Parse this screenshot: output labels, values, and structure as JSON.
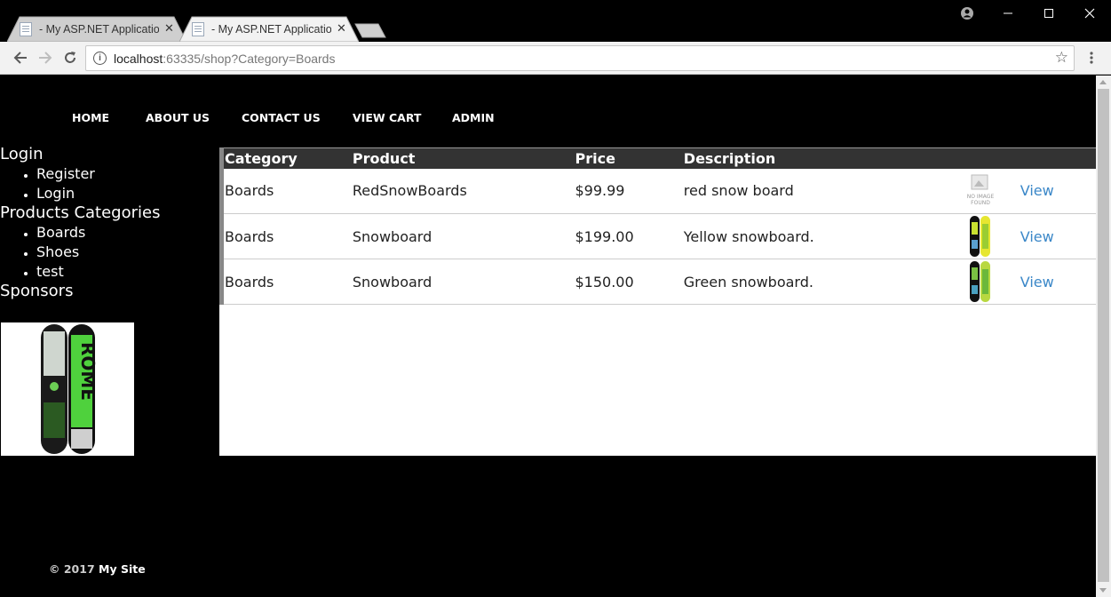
{
  "browser": {
    "tabs": [
      {
        "title": "- My ASP.NET Application",
        "active": false
      },
      {
        "title": "- My ASP.NET Application",
        "active": true
      }
    ],
    "url_host": "localhost",
    "url_rest": ":63335/shop?Category=Boards"
  },
  "nav": {
    "items": [
      "HOME",
      "ABOUT US",
      "CONTACT US",
      "VIEW CART",
      "ADMIN"
    ]
  },
  "sidebar": {
    "login_heading": "Login",
    "login_items": [
      "Register",
      "Login"
    ],
    "categories_heading": "Products Categories",
    "categories": [
      "Boards",
      "Shoes",
      "test"
    ],
    "sponsors_heading": "Sponsors"
  },
  "products": {
    "headers": [
      "Category",
      "Product",
      "Price",
      "Description"
    ],
    "rows": [
      {
        "category": "Boards",
        "product": "RedSnowBoards",
        "price": "$99.99",
        "description": "red snow board",
        "image": "no-image",
        "link": "View"
      },
      {
        "category": "Boards",
        "product": "Snowboard",
        "price": "$199.00",
        "description": "Yellow snowboard.",
        "image": "snowboard-yellow",
        "link": "View"
      },
      {
        "category": "Boards",
        "product": "Snowboard",
        "price": "$150.00",
        "description": "Green snowboard.",
        "image": "snowboard-green",
        "link": "View"
      }
    ],
    "no_image_text": [
      "NO IMAGE",
      "FOUND"
    ]
  },
  "footer": {
    "copyright": "© 2017",
    "site": "My Site"
  },
  "colors": {
    "link": "#3a87c8",
    "header_bg": "#333333",
    "page_bg": "#000000"
  }
}
